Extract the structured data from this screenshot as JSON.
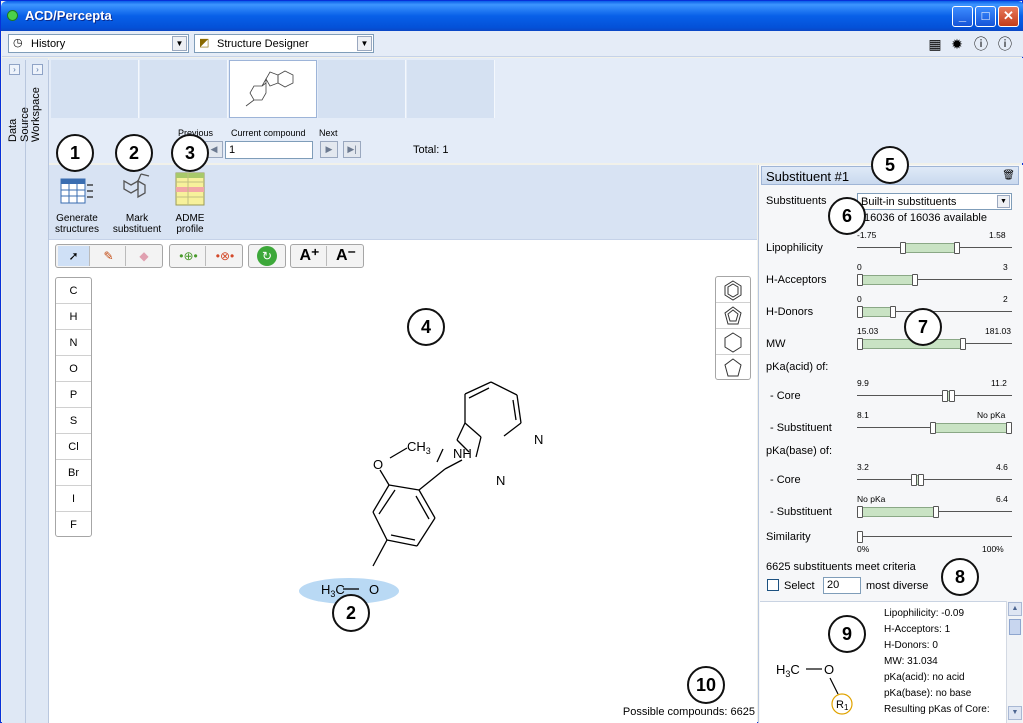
{
  "window": {
    "title": "ACD/Percepta",
    "controls": {
      "minimize": "_",
      "maximize": "□",
      "close": "✕"
    }
  },
  "toolbar": {
    "history_label": "History",
    "designer_label": "Structure Designer",
    "icons": [
      "calculator-icon",
      "settings-icon",
      "help-icon",
      "info-icon"
    ]
  },
  "side_tabs": [
    "Data Source",
    "Workspace"
  ],
  "navigator": {
    "previous_label": "Previous",
    "current_label": "Current compound",
    "next_label": "Next",
    "current_value": "1",
    "total_text": "Total: 1"
  },
  "actions": [
    {
      "label_line1": "Generate",
      "label_line2": "structures"
    },
    {
      "label_line1": "Mark",
      "label_line2": "substituent"
    },
    {
      "label_line1": "ADME",
      "label_line2": "profile"
    }
  ],
  "editor": {
    "atoms": [
      "C",
      "H",
      "N",
      "O",
      "P",
      "S",
      "Cl",
      "Br",
      "I",
      "F"
    ],
    "molecule_labels": {
      "methyl": "CH",
      "methyl_sub": "3",
      "o_top": "O",
      "nh": "NH",
      "n_imidazole": "N",
      "n_pyridine": "N",
      "h3c_h": "H",
      "h3c_3": "3",
      "h3c_c": "C",
      "o_bottom": "O"
    },
    "possible_compounds": "Possible compounds: 6625"
  },
  "callouts": [
    "1",
    "2",
    "3",
    "4",
    "5",
    "6",
    "7",
    "8",
    "9",
    "10",
    "2"
  ],
  "panel": {
    "title": "Substituent #1",
    "substituents_label": "Substituents",
    "substituents_value": "Built-in substituents",
    "available_text": "16036 of 16036 available",
    "sliders": [
      {
        "label": "Lipophilicity",
        "min_label": "-1.75",
        "max_label": "1.58",
        "low": 0.29,
        "high": 0.65
      },
      {
        "label": "H-Acceptors",
        "min_label": "0",
        "max_label": "3",
        "low": 0.0,
        "high": 0.37
      },
      {
        "label": "H-Donors",
        "min_label": "0",
        "max_label": "2",
        "low": 0.0,
        "high": 0.22
      },
      {
        "label": "MW",
        "min_label": "15.03",
        "max_label": "181.03",
        "low": 0.0,
        "high": 0.69
      }
    ],
    "pka_acid_label": "pKa(acid) of:",
    "pka_acid": [
      {
        "label": "- Core",
        "min_label": "9.9",
        "max_label": "11.2",
        "low": 0.57,
        "high": 0.62
      },
      {
        "label": "- Substituent",
        "min_label": "8.1",
        "max_label": "No pKa",
        "low": 0.49,
        "high": 1.0
      }
    ],
    "pka_base_label": "pKa(base) of:",
    "pka_base": [
      {
        "label": "- Core",
        "min_label": "3.2",
        "max_label": "4.6",
        "low": 0.36,
        "high": 0.41
      },
      {
        "label": "- Substituent",
        "min_label": "No pKa",
        "max_label": "6.4",
        "low": 0.0,
        "high": 0.51
      }
    ],
    "similarity": {
      "label": "Similarity",
      "min_label": "0%",
      "max_label": "100%",
      "low": 0.0,
      "high": 0.0
    },
    "criteria_text": "6625 substituents meet criteria",
    "select_label": "Select",
    "select_count": "20",
    "most_diverse_label": "most diverse",
    "result": {
      "h3c": "H",
      "h3c_3": "3",
      "h3c_c": "C",
      "o": "O",
      "r": "R",
      "r_sub": "1",
      "props": [
        "Lipophilicity: -0.09",
        "H-Acceptors: 1",
        "H-Donors: 0",
        "MW: 31.034",
        "pKa(acid): no acid",
        "pKa(base): no base",
        "Resulting pKas of Core:"
      ]
    }
  }
}
